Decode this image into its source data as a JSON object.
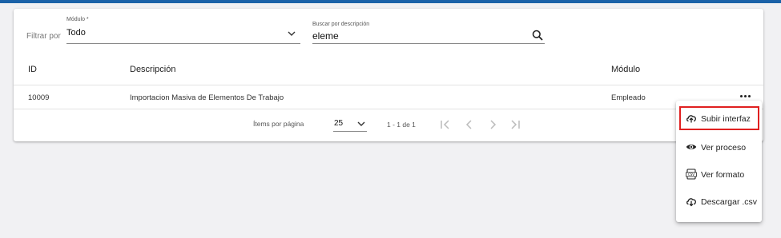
{
  "filters": {
    "filter_label": "Filtrar por",
    "modulo": {
      "label": "Módulo *",
      "value": "Todo"
    },
    "buscar": {
      "label": "Buscar por descripción",
      "value": "eleme"
    }
  },
  "table": {
    "headers": {
      "id": "ID",
      "descripcion": "Descripción",
      "modulo": "Módulo"
    },
    "rows": [
      {
        "id": "10009",
        "descripcion": "Importacion Masiva de Elementos De Trabajo",
        "modulo": "Empleado"
      }
    ]
  },
  "paginator": {
    "items_label": "Ítems por página",
    "page_size": "25",
    "range": "1 - 1 de 1"
  },
  "menu": {
    "items": [
      {
        "label": "Subir interfaz",
        "icon": "cloud-upload-icon"
      },
      {
        "label": "Ver proceso",
        "icon": "eye-icon"
      },
      {
        "label": "Ver formato",
        "icon": "csv-file-icon"
      },
      {
        "label": "Descargar .csv",
        "icon": "cloud-download-icon"
      }
    ]
  },
  "colors": {
    "top_accent": "#1b62a8",
    "highlight_border": "#e02020"
  }
}
